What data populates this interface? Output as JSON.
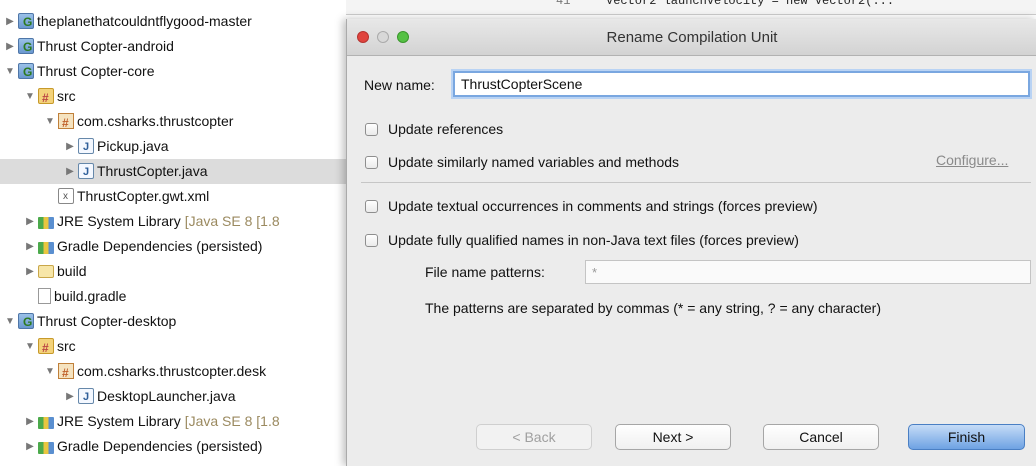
{
  "editor": {
    "line_number": "41",
    "code": "Vector2 launchVelocity = new Vector2(..."
  },
  "tree": {
    "rows": [
      {
        "depth": 0,
        "twisty": "closed",
        "icon": "project-icon",
        "label": "theplanethatcouldntflygood-master",
        "extra": ""
      },
      {
        "depth": 0,
        "twisty": "closed",
        "icon": "project-icon",
        "label": "Thrust Copter-android",
        "extra": ""
      },
      {
        "depth": 0,
        "twisty": "open",
        "icon": "project-icon",
        "label": "Thrust Copter-core",
        "extra": ""
      },
      {
        "depth": 1,
        "twisty": "open",
        "icon": "source-folder-icon",
        "label": "src",
        "extra": ""
      },
      {
        "depth": 2,
        "twisty": "open",
        "icon": "package-icon",
        "label": "com.csharks.thrustcopter",
        "extra": ""
      },
      {
        "depth": 3,
        "twisty": "closed",
        "icon": "java-file-icon",
        "label": "Pickup.java",
        "extra": ""
      },
      {
        "depth": 3,
        "twisty": "closed",
        "icon": "java-file-icon",
        "label": "ThrustCopter.java",
        "extra": "",
        "selected": true
      },
      {
        "depth": 2,
        "twisty": "none",
        "icon": "xml-file-icon",
        "label": "ThrustCopter.gwt.xml",
        "extra": ""
      },
      {
        "depth": 1,
        "twisty": "closed",
        "icon": "library-icon",
        "label": "JRE System Library",
        "extra": "[Java SE 8 [1.8"
      },
      {
        "depth": 1,
        "twisty": "closed",
        "icon": "library-icon",
        "label": "Gradle Dependencies (persisted)",
        "extra": ""
      },
      {
        "depth": 1,
        "twisty": "closed",
        "icon": "folder-icon",
        "label": "build",
        "extra": ""
      },
      {
        "depth": 1,
        "twisty": "none",
        "icon": "file-icon",
        "label": "build.gradle",
        "extra": ""
      },
      {
        "depth": 0,
        "twisty": "open",
        "icon": "project-icon",
        "label": "Thrust Copter-desktop",
        "extra": ""
      },
      {
        "depth": 1,
        "twisty": "open",
        "icon": "source-folder-icon",
        "label": "src",
        "extra": ""
      },
      {
        "depth": 2,
        "twisty": "open",
        "icon": "package-icon",
        "label": "com.csharks.thrustcopter.desk",
        "extra": ""
      },
      {
        "depth": 3,
        "twisty": "closed",
        "icon": "java-file-icon",
        "label": "DesktopLauncher.java",
        "extra": ""
      },
      {
        "depth": 1,
        "twisty": "closed",
        "icon": "library-icon",
        "label": "JRE System Library",
        "extra": "[Java SE 8 [1.8"
      },
      {
        "depth": 1,
        "twisty": "closed",
        "icon": "library-icon",
        "label": "Gradle Dependencies (persisted)",
        "extra": ""
      }
    ]
  },
  "dialog": {
    "title": "Rename Compilation Unit",
    "new_name_label": "New name:",
    "new_name_value": "ThrustCopterScene",
    "options": {
      "update_references": "Update references",
      "update_similar": "Update similarly named variables and methods",
      "configure": "Configure...",
      "update_textual": "Update textual occurrences in comments and strings (forces preview)",
      "update_qualified": "Update fully qualified names in non-Java text files (forces preview)"
    },
    "checked": {
      "update_references": false,
      "update_similar": false,
      "update_textual": false,
      "update_qualified": false
    },
    "file_name_patterns_label": "File name patterns:",
    "file_name_patterns_value": "*",
    "patterns_help": "The patterns are separated by commas (* = any string, ? = any character)",
    "buttons": {
      "back": "< Back",
      "next": "Next >",
      "cancel": "Cancel",
      "finish": "Finish"
    }
  },
  "colors": {
    "selection": "#dcdcdc",
    "focus_ring": "#7aa7e0",
    "default_button": "#6ea2e3",
    "close": "#e0443e",
    "zoom": "#55c144"
  }
}
